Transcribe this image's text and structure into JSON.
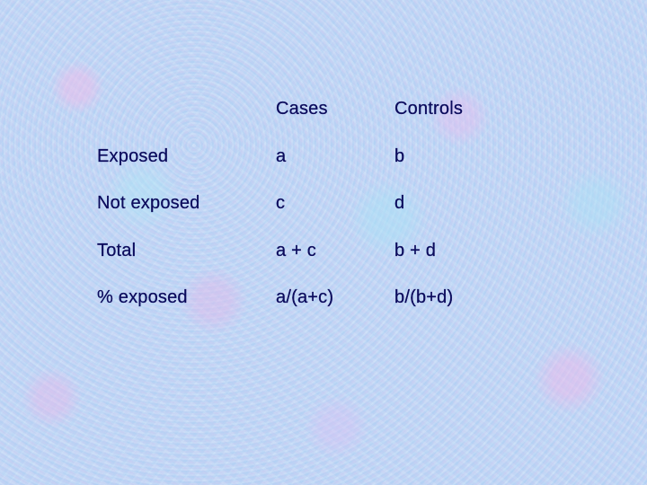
{
  "table": {
    "columns": [
      "",
      "Cases",
      "Controls"
    ],
    "rows": [
      {
        "label": "Exposed",
        "cases": "a",
        "controls": "b"
      },
      {
        "label": "Not exposed",
        "cases": "c",
        "controls": "d"
      },
      {
        "label": "Total",
        "cases": "a + c",
        "controls": "b + d"
      },
      {
        "label": "% exposed",
        "cases": "a/(a+c)",
        "controls": "b/(b+d)"
      }
    ]
  },
  "colors": {
    "text": "#0b0b5c",
    "background": "#bcd6f5"
  }
}
